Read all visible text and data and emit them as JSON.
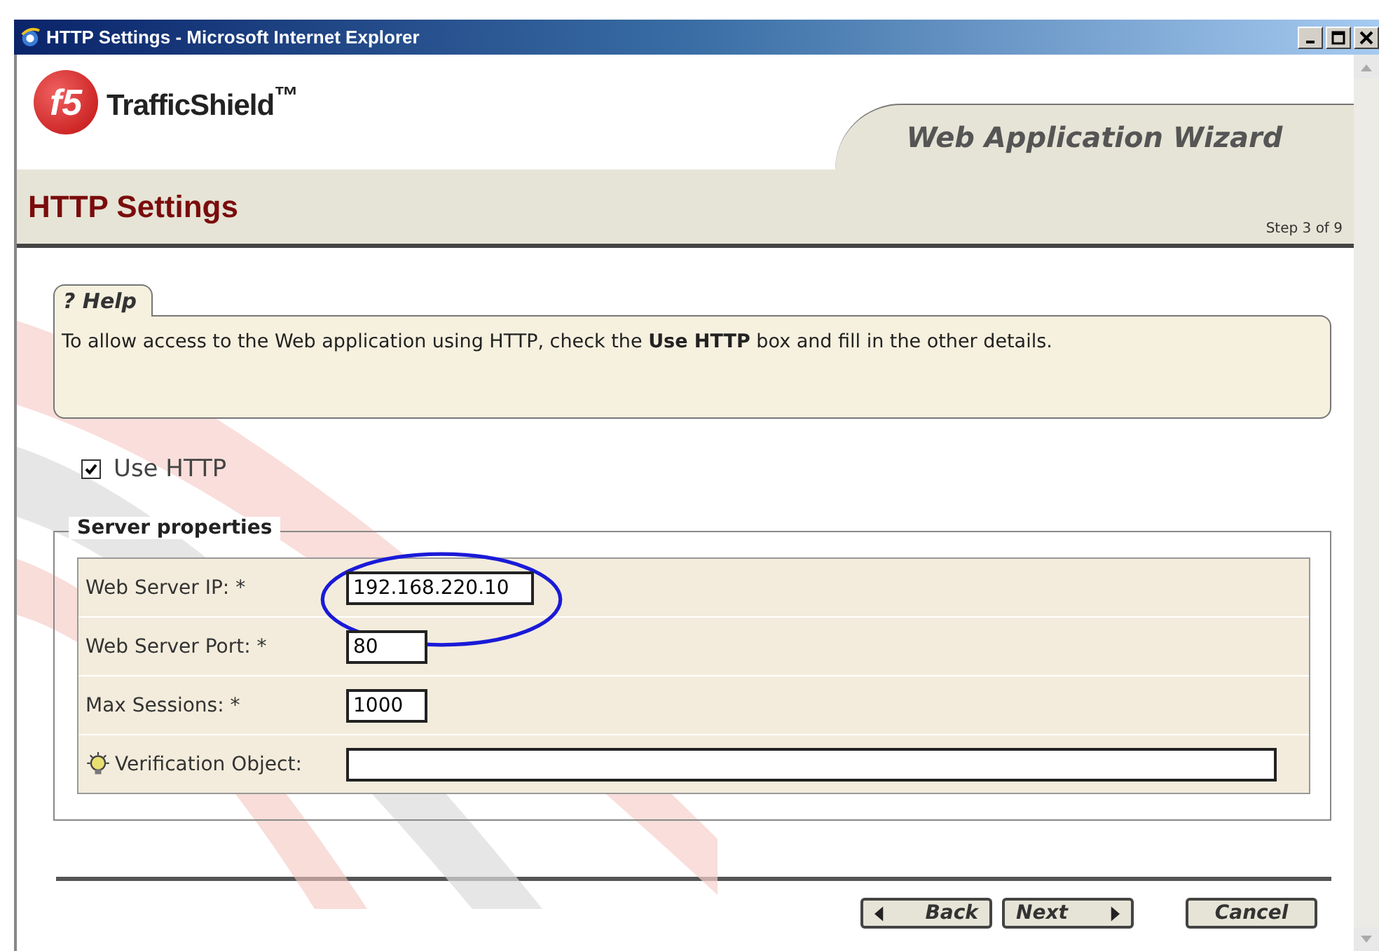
{
  "window": {
    "title": "HTTP Settings - Microsoft Internet Explorer"
  },
  "header": {
    "logo_mark": "f5",
    "product": "TrafficShield$^{™}$",
    "wizard_title": "Web Application Wizard"
  },
  "page": {
    "title": "HTTP Settings",
    "step": "Step 3 of 9"
  },
  "help": {
    "tab": "? Help",
    "text": "To allow access to the Web application using HTTP, check the **Use HTTP** box and fill in the other details."
  },
  "use_http": {
    "label": "Use HTTP",
    "checked": true
  },
  "server_properties": {
    "legend": "Server properties",
    "fields": [
      {
        "kind": "plain",
        "label": "Web Server IP: *",
        "value": "192.168.220.10"
      },
      {
        "kind": "plain",
        "label": "Web Server Port: *",
        "value": "80"
      },
      {
        "kind": "plain",
        "label": "Max Sessions: *",
        "value": "1000"
      },
      {
        "kind": "hint",
        "label": "Verification Object:"
      }
    ]
  },
  "buttons": [
    {
      "kind": "back",
      "label": "Back"
    },
    {
      "kind": "next",
      "label": "Next"
    },
    {
      "kind": "cancel",
      "label": "Cancel"
    }
  ]
}
